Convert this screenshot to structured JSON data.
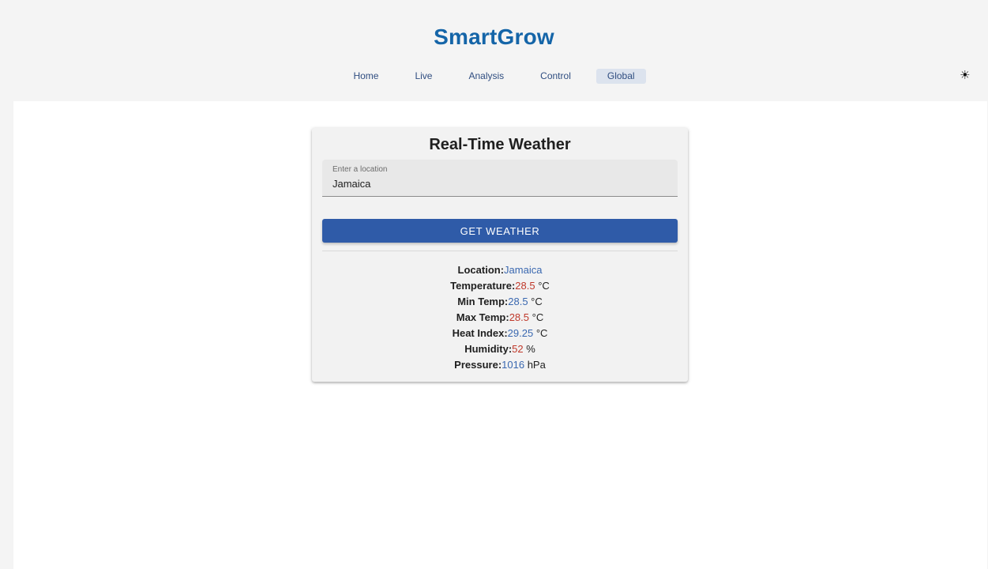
{
  "app": {
    "title": "SmartGrow"
  },
  "nav": {
    "items": [
      {
        "label": "Home"
      },
      {
        "label": "Live"
      },
      {
        "label": "Analysis"
      },
      {
        "label": "Control"
      },
      {
        "label": "Global"
      }
    ],
    "active": "Global"
  },
  "theme_toggle": {
    "icon": "sun-icon",
    "glyph": "☀"
  },
  "weather_card": {
    "title": "Real-Time Weather",
    "location_field": {
      "label": "Enter a location",
      "value": "Jamaica"
    },
    "button_label": "GET WEATHER",
    "results": {
      "location": {
        "label": "Location:",
        "value": "Jamaica"
      },
      "temperature": {
        "label": "Temperature:",
        "value": "28.5",
        "unit": " °C"
      },
      "min_temp": {
        "label": "Min Temp:",
        "value": "28.5",
        "unit": " °C"
      },
      "max_temp": {
        "label": "Max Temp:",
        "value": "28.5",
        "unit": " °C"
      },
      "heat_index": {
        "label": "Heat Index:",
        "value": "29.25",
        "unit": " °C"
      },
      "humidity": {
        "label": "Humidity:",
        "value": "52",
        "unit": " %"
      },
      "pressure": {
        "label": "Pressure:",
        "value": "1016",
        "unit": " hPa"
      }
    }
  },
  "colors": {
    "brand": "#1565a8",
    "button": "#2f5ba8",
    "value_blue": "#3a68b0",
    "value_red": "#c0392b"
  }
}
